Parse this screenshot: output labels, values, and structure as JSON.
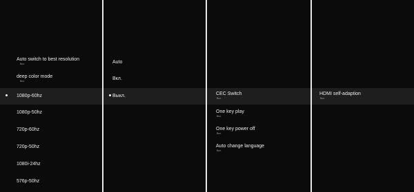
{
  "resolution_menu": {
    "items": [
      {
        "label": "Auto switch to best resolution",
        "sub": "Вкл."
      },
      {
        "label": "deep color mode",
        "sub": "Вкл."
      },
      {
        "label": "1080p-60hz",
        "selected": true
      },
      {
        "label": "1080p-50hz"
      },
      {
        "label": "720p-60hz"
      },
      {
        "label": "720p-50hz"
      },
      {
        "label": "1080i-24hz"
      },
      {
        "label": "576p-50hz"
      }
    ]
  },
  "option_menu": {
    "items": [
      {
        "label": "Auto"
      },
      {
        "label": "Вкл."
      },
      {
        "label": "Выкл.",
        "selected": true
      }
    ]
  },
  "cec_menu": {
    "items": [
      {
        "label": "CEC Switch",
        "sub": "Вкл."
      },
      {
        "label": "One key play",
        "sub": "Вкл."
      },
      {
        "label": "One key power off",
        "sub": "Вкл."
      },
      {
        "label": "Auto change language",
        "sub": "Вкл."
      }
    ]
  },
  "hdmi_menu": {
    "items": [
      {
        "label": "HDMI self-adaption",
        "sub": "Вкл."
      }
    ]
  },
  "colors": {
    "background": "#0b0b0b",
    "highlight_row": "#1e1e1e",
    "divider": "#e9e9e9",
    "text": "#ececec",
    "subtext": "#9a9a9a"
  },
  "icons": {
    "selected_marker": "selected-dot-icon"
  }
}
